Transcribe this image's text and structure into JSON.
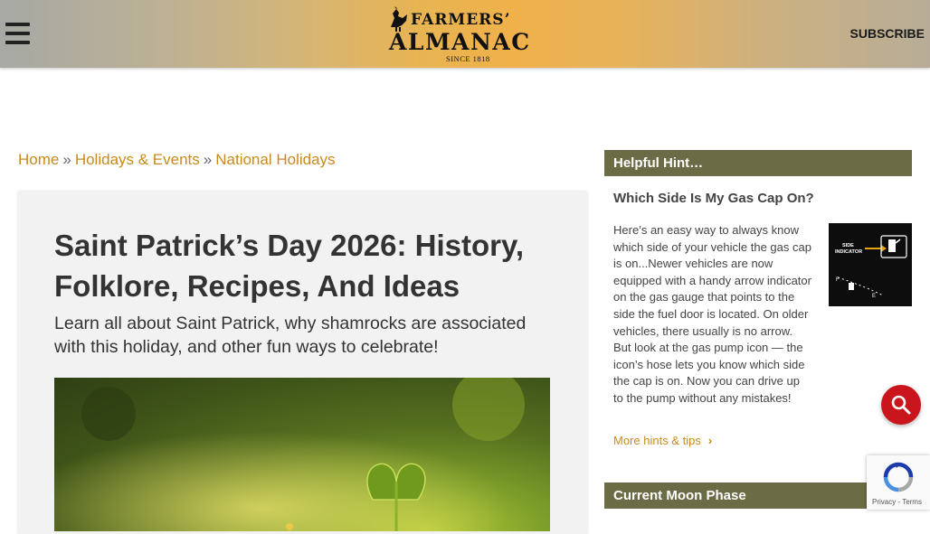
{
  "header": {
    "menu_icon": "hamburger-icon",
    "logo": {
      "line1": "FARMERS’",
      "line2": "ALMANAC",
      "line3": "SINCE 1818"
    },
    "subscribe_label": "SUBSCRIBE"
  },
  "breadcrumb": {
    "items": [
      "Home",
      "Holidays & Events",
      "National Holidays"
    ],
    "separator": "»"
  },
  "article": {
    "title": "Saint Patrick’s Day 2026: History, Folklore, Recipes, And Ideas",
    "subtitle": "Learn all about Saint Patrick, why shamrocks are associated with this holiday, and other fun ways to celebrate!"
  },
  "sidebar": {
    "hint_heading": "Helpful Hint…",
    "hint_title": "Which Side Is My Gas Cap On?",
    "hint_text": "Here’s an easy way to always know which side of your vehicle the gas cap is on...Newer vehicles are now equipped with a handy arrow indicator on the gas gauge that points to the side the fuel door is located. On older vehicles, there usually is no arrow. But look at the gas pump icon — the icon’s hose lets you know which side the cap is on. Now you can drive up to the pump without any mistakes!",
    "gauge_label": "SIDE INDICATOR",
    "more_label": "More hints & tips",
    "moon_heading": "Current Moon Phase"
  },
  "floating": {
    "search_icon": "search-icon",
    "recaptcha_label": "Privacy - Terms"
  },
  "colors": {
    "link": "#c98a1a",
    "sidebar_header_bg": "#6b6b45",
    "search_fab": "#c9151b"
  }
}
